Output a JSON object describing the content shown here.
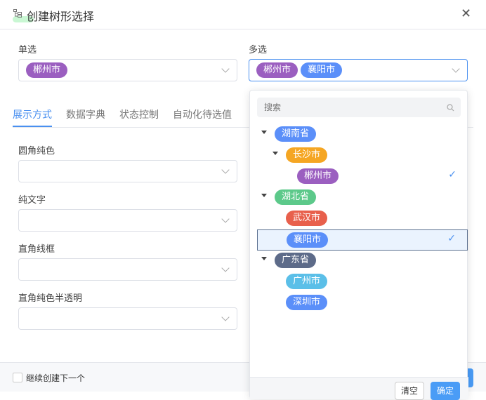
{
  "dialog": {
    "title": "创建树形选择",
    "close_icon": "close-icon"
  },
  "single": {
    "label": "单选",
    "tags": [
      {
        "text": "郴州市",
        "color": "#9b5fc0"
      }
    ]
  },
  "multi": {
    "label": "多选",
    "tags": [
      {
        "text": "郴州市",
        "color": "#9b5fc0"
      },
      {
        "text": "襄阳市",
        "color": "#5b8ff9"
      }
    ]
  },
  "tabs": [
    "展示方式",
    "数据字典",
    "状态控制",
    "自动化待选值"
  ],
  "fields": [
    {
      "label": "圆角纯色"
    },
    {
      "label": "纯文字"
    },
    {
      "label": "直角线框"
    },
    {
      "label": "直角纯色半透明"
    }
  ],
  "footer": {
    "checkbox_label": "继续创建下一个"
  },
  "dropdown": {
    "search_placeholder": "搜索",
    "nodes": [
      {
        "text": "湖南省",
        "color": "#5b8ff9",
        "level": 0,
        "expanded": true
      },
      {
        "text": "长沙市",
        "color": "#f5a623",
        "level": 1,
        "expanded": true
      },
      {
        "text": "郴州市",
        "color": "#9b5fc0",
        "level": 2,
        "checked": true
      },
      {
        "text": "湖北省",
        "color": "#5cc98a",
        "level": 0,
        "expanded": true
      },
      {
        "text": "武汉市",
        "color": "#e8604c",
        "level": 1
      },
      {
        "text": "襄阳市",
        "color": "#5b8ff9",
        "level": 1,
        "checked": true,
        "highlighted": true
      },
      {
        "text": "广东省",
        "color": "#5d6b89",
        "level": 0,
        "expanded": true
      },
      {
        "text": "广州市",
        "color": "#5bbfe8",
        "level": 1
      },
      {
        "text": "深圳市",
        "color": "#5b8ff9",
        "level": 1
      }
    ],
    "clear_label": "清空",
    "confirm_label": "确定"
  }
}
